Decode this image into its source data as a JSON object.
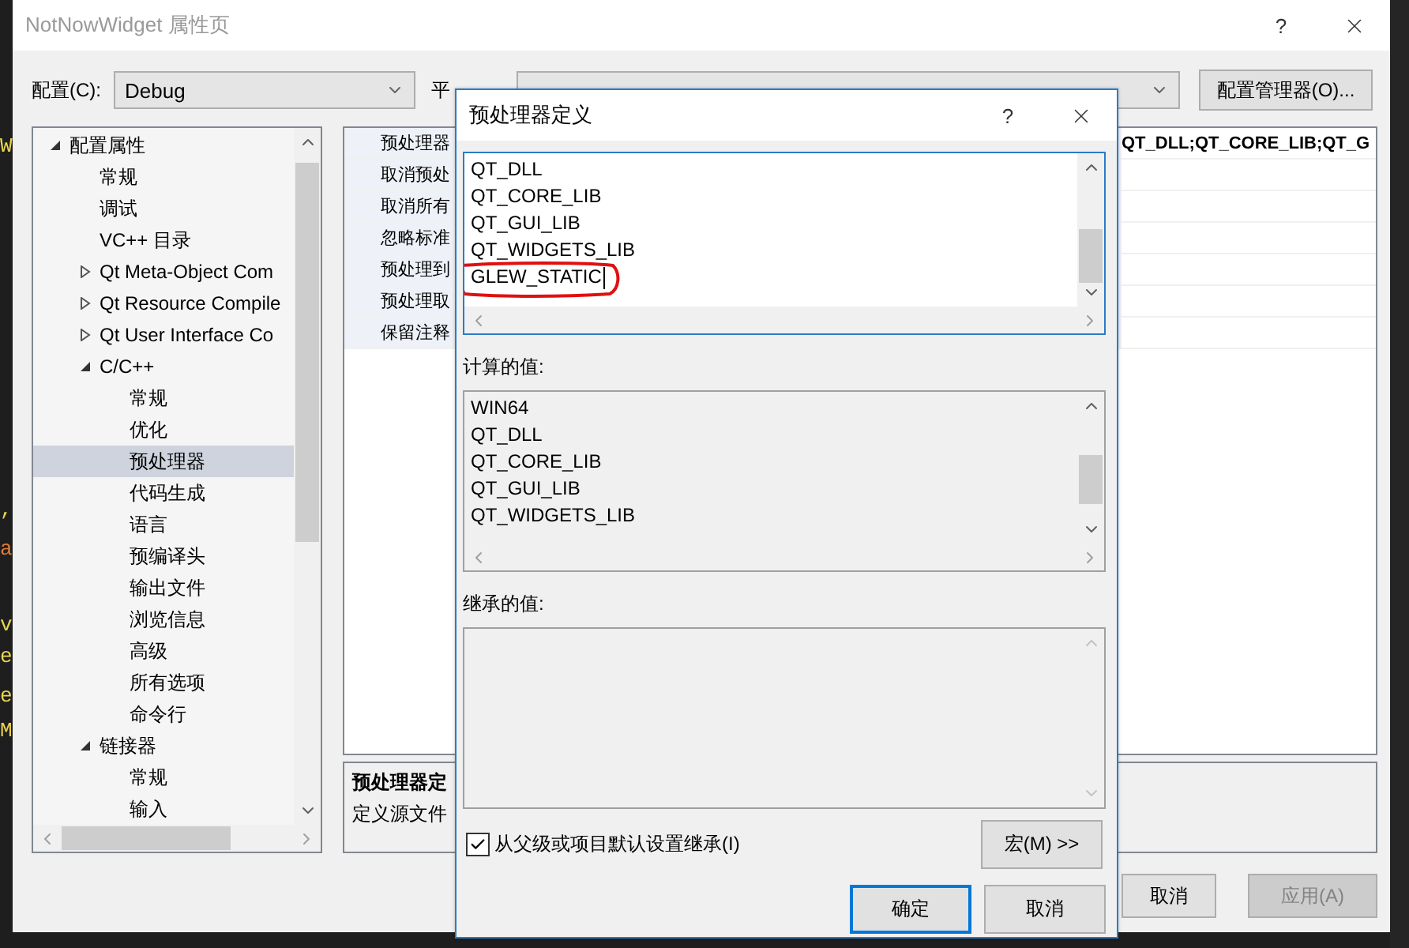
{
  "editor_glimpse": [
    {
      "text": "W",
      "color": "#e8d44d"
    },
    {
      "text": ",",
      "color": "#e8d44d"
    },
    {
      "text": "a",
      "color": "#e07b39"
    },
    {
      "text": "v",
      "color": "#e8d44d"
    },
    {
      "text": "e",
      "color": "#e8d44d"
    },
    {
      "text": "e",
      "color": "#e8d44d"
    },
    {
      "text": "M",
      "color": "#e8d44d"
    }
  ],
  "window": {
    "title": "NotNowWidget 属性页",
    "help": "?"
  },
  "configuration": {
    "label": "配置(C):",
    "value": "Debug"
  },
  "platform": {
    "label": "平"
  },
  "config_manager_button": "配置管理器(O)...",
  "tree": [
    {
      "label": "配置属性",
      "expanded": true,
      "selected": false,
      "children": [
        {
          "label": "常规",
          "selected": false
        },
        {
          "label": "调试",
          "selected": false
        },
        {
          "label": "VC++ 目录",
          "selected": false
        },
        {
          "label": "Qt Meta-Object Com",
          "expanded": false,
          "selected": false
        },
        {
          "label": "Qt Resource Compile",
          "expanded": false,
          "selected": false
        },
        {
          "label": "Qt User Interface Co",
          "expanded": false,
          "selected": false
        },
        {
          "label": "C/C++",
          "expanded": true,
          "selected": false,
          "children": [
            {
              "label": "常规",
              "selected": false
            },
            {
              "label": "优化",
              "selected": false
            },
            {
              "label": "预处理器",
              "selected": true
            },
            {
              "label": "代码生成",
              "selected": false
            },
            {
              "label": "语言",
              "selected": false
            },
            {
              "label": "预编译头",
              "selected": false
            },
            {
              "label": "输出文件",
              "selected": false
            },
            {
              "label": "浏览信息",
              "selected": false
            },
            {
              "label": "高级",
              "selected": false
            },
            {
              "label": "所有选项",
              "selected": false
            },
            {
              "label": "命令行",
              "selected": false
            }
          ]
        },
        {
          "label": "链接器",
          "expanded": true,
          "selected": false,
          "children": [
            {
              "label": "常规",
              "selected": false
            },
            {
              "label": "输入",
              "selected": false
            }
          ]
        }
      ]
    }
  ],
  "properties": [
    {
      "label": "预处理器",
      "value": "QT_DLL;QT_CORE_LIB;QT_G"
    },
    {
      "label": "取消预处"
    },
    {
      "label": "取消所有"
    },
    {
      "label": "忽略标准"
    },
    {
      "label": "预处理到"
    },
    {
      "label": "预处理取"
    },
    {
      "label": "保留注释"
    }
  ],
  "description": {
    "title": "预处理器定",
    "text": "定义源文件"
  },
  "buttons": [
    {
      "label": "取消",
      "disabled": false
    },
    {
      "label": "应用(A)",
      "disabled": true
    }
  ],
  "dialog": {
    "title": "预处理器定义",
    "help": "?",
    "definitions": [
      {
        "text": "QT_DLL",
        "circled": false,
        "caret": false
      },
      {
        "text": "QT_CORE_LIB",
        "circled": false,
        "caret": false
      },
      {
        "text": "QT_GUI_LIB",
        "circled": false,
        "caret": false
      },
      {
        "text": "QT_WIDGETS_LIB",
        "circled": false,
        "caret": false
      },
      {
        "text": "GLEW_STATIC",
        "circled": true,
        "caret": true
      }
    ],
    "computed_label": "计算的值:",
    "computed": [
      "WIN64",
      "QT_DLL",
      "QT_CORE_LIB",
      "QT_GUI_LIB",
      "QT_WIDGETS_LIB"
    ],
    "inherited_label": "继承的值:",
    "inherit_checkbox": {
      "label": "从父级或项目默认设置继承(I)",
      "checked": true
    },
    "macros_button": "宏(M) >>",
    "buttons": [
      {
        "label": "确定",
        "focused": true
      },
      {
        "label": "取消",
        "focused": false
      }
    ]
  }
}
